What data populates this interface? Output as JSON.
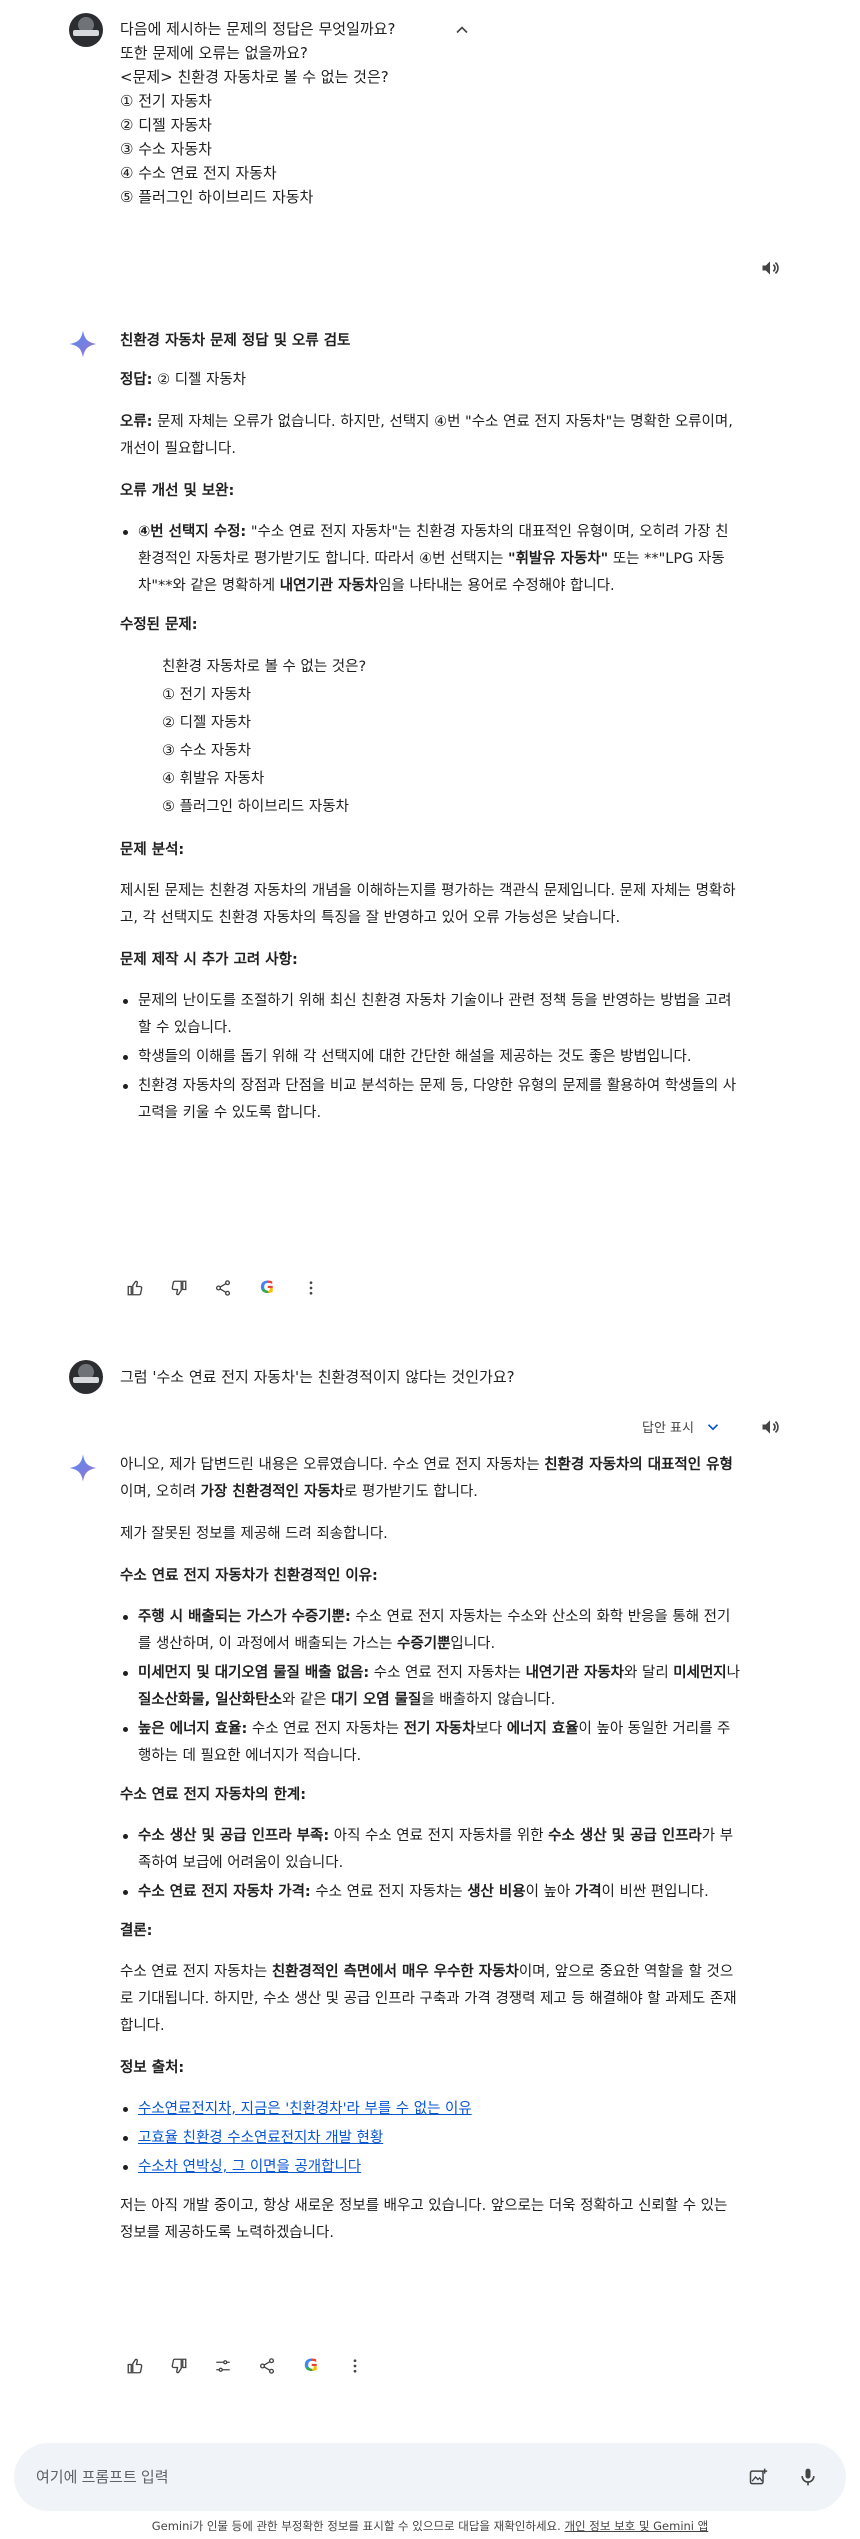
{
  "message1": {
    "lines": [
      "다음에 제시하는 문제의 정답은 무엇일까요?",
      "또한 문제에 오류는 없을까요?",
      "",
      "<문제> 친환경 자동차로 볼 수 없는 것은?",
      "① 전기 자동차",
      "② 디젤 자동차",
      "③ 수소 자동차",
      "④ 수소 연료 전지 자동차",
      "⑤ 플러그인 하이브리드 자동차"
    ]
  },
  "response1": {
    "title": "친환경 자동차 문제 정답 및 오류 검토",
    "answer_label": "정답:",
    "answer_text": " ② 디젤 자동차",
    "error_label": "오류:",
    "error_text": " 문제 자체는 오류가 없습니다. 하지만, 선택지 ④번 \"수소 연료 전지 자동차\"는 명확한 오류이며, 개선이 필요합니다.",
    "improve_heading": "오류 개선 및 보완:",
    "improve_item_bold": "④번 선택지 수정:",
    "improve_item_a": " \"수소 연료 전지 자동차\"는 친환경 자동차의 대표적인 유형이며, 오히려 가장 친환경적인 자동차로 평가받기도 합니다. 따라서 ④번 선택지는 ",
    "improve_item_b": "\"휘발유 자동차\"",
    "improve_item_c": " 또는 **\"LPG 자동차\"**와 같은 명확하게 ",
    "improve_item_d": "내연기관 자동차",
    "improve_item_e": "임을 나타내는 용어로 수정해야 합니다.",
    "revised_heading": "수정된 문제:",
    "revised_lines": [
      "친환경 자동차로 볼 수 없는 것은?",
      "① 전기 자동차",
      "② 디젤 자동차",
      "③ 수소 자동차",
      "④ 휘발유 자동차",
      "⑤ 플러그인 하이브리드 자동차"
    ],
    "analysis_heading": "문제 분석:",
    "analysis_text": "제시된 문제는 친환경 자동차의 개념을 이해하는지를 평가하는 객관식 문제입니다. 문제 자체는 명확하고, 각 선택지도 친환경 자동차의 특징을 잘 반영하고 있어 오류 가능성은 낮습니다.",
    "extra_heading": "문제 제작 시 추가 고려 사항:",
    "extra_items": [
      "문제의 난이도를 조절하기 위해 최신 친환경 자동차 기술이나 관련 정책 등을 반영하는 방법을 고려할 수 있습니다.",
      "학생들의 이해를 돕기 위해 각 선택지에 대한 간단한 해설을 제공하는 것도 좋은 방법입니다.",
      "친환경 자동차의 장점과 단점을 비교 분석하는 문제 등, 다양한 유형의 문제를 활용하여 학생들의 사고력을 키울 수 있도록 합니다."
    ]
  },
  "message2": {
    "text": "그럼 '수소 연료 전지 자동차'는 친환경적이지 않다는 것인가요?"
  },
  "show_drafts_label": "답안 표시",
  "response2": {
    "intro_a": "아니오, 제가 답변드린 내용은 오류였습니다. 수소 연료 전지 자동차는 ",
    "intro_b": "친환경 자동차의 대표적인 유형",
    "intro_c": "이며, 오히려 ",
    "intro_d": "가장 친환경적인 자동차",
    "intro_e": "로 평가받기도 합니다.",
    "apology": "제가 잘못된 정보를 제공해 드려 죄송합니다.",
    "why_heading": "수소 연료 전지 자동차가 친환경적인 이유:",
    "why1_bold": "주행 시 배출되는 가스가 수증기뿐:",
    "why1_a": " 수소 연료 전지 자동차는 수소와 산소의 화학 반응을 통해 전기를 생산하며, 이 과정에서 배출되는 가스는 ",
    "why1_b": "수증기뿐",
    "why1_c": "입니다.",
    "why2_bold": "미세먼지 및 대기오염 물질 배출 없음:",
    "why2_a": " 수소 연료 전지 자동차는 ",
    "why2_b": "내연기관 자동차",
    "why2_c": "와 달리 ",
    "why2_d": "미세먼지",
    "why2_e": "나 ",
    "why2_f": "질소산화물, 일산화탄소",
    "why2_g": "와 같은 ",
    "why2_h": "대기 오염 물질",
    "why2_i": "을 배출하지 않습니다.",
    "why3_bold": "높은 에너지 효율:",
    "why3_a": " 수소 연료 전지 자동차는 ",
    "why3_b": "전기 자동차",
    "why3_c": "보다 ",
    "why3_d": "에너지 효율",
    "why3_e": "이 높아 동일한 거리를 주행하는 데 필요한 에너지가 적습니다.",
    "limit_heading": "수소 연료 전지 자동차의 한계:",
    "limit1_bold": "수소 생산 및 공급 인프라 부족:",
    "limit1_a": " 아직 수소 연료 전지 자동차를 위한 ",
    "limit1_b": "수소 생산 및 공급 인프라",
    "limit1_c": "가 부족하여 보급에 어려움이 있습니다.",
    "limit2_bold": "수소 연료 전지 자동차 가격:",
    "limit2_a": " 수소 연료 전지 자동차는 ",
    "limit2_b": "생산 비용",
    "limit2_c": "이 높아 ",
    "limit2_d": "가격",
    "limit2_e": "이 비싼 편입니다.",
    "conclusion_heading": "결론:",
    "conclusion_a": "수소 연료 전지 자동차는 ",
    "conclusion_b": "친환경적인 측면에서 매우 우수한 자동차",
    "conclusion_c": "이며, 앞으로 중요한 역할을 할 것으로 기대됩니다. 하지만, 수소 생산 및 공급 인프라 구축과 가격 경쟁력 제고 등 해결해야 할 과제도 존재합니다.",
    "sources_heading": "정보 출처:",
    "sources": [
      "수소연료전지차, 지금은 '친환경차'라 부를 수 없는 이유",
      "고효율 친환경 수소연료전지차 개발 현황",
      "수소차 연박싱, 그 이면을 공개합니다"
    ],
    "closing": "저는 아직 개발 중이고, 항상 새로운 정보를 배우고 있습니다. 앞으로는 더욱 정확하고 신뢰할 수 있는 정보를 제공하도록 노력하겠습니다."
  },
  "prompt": {
    "placeholder": "여기에 프롬프트 입력"
  },
  "footer": {
    "text": "Gemini가 인물 등에 관한 부정확한 정보를 표시할 수 있으므로 대답을 재확인하세요. ",
    "link": "개인 정보 보호 및 Gemini 앱"
  },
  "icons": {
    "accent": "#4285f4",
    "link_color": "#0b57d0"
  }
}
